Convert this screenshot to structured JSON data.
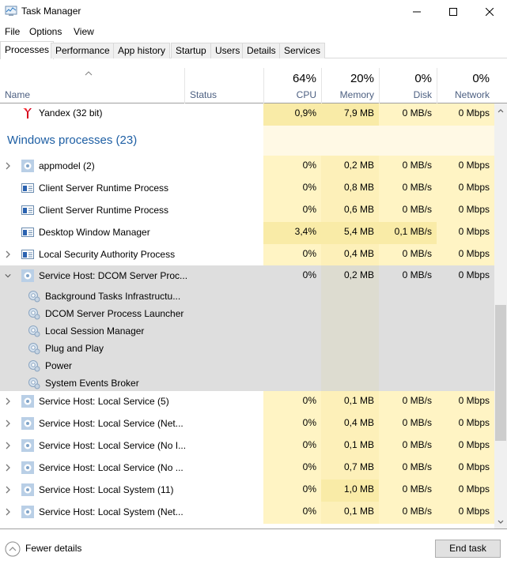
{
  "window": {
    "title": "Task Manager"
  },
  "menu": [
    "File",
    "Options",
    "View"
  ],
  "tabs": [
    {
      "label": "Processes",
      "active": true
    },
    {
      "label": "Performance",
      "active": false
    },
    {
      "label": "App history",
      "active": false
    },
    {
      "label": "Startup",
      "active": false
    },
    {
      "label": "Users",
      "active": false
    },
    {
      "label": "Details",
      "active": false
    },
    {
      "label": "Services",
      "active": false
    }
  ],
  "columns": {
    "name": "Name",
    "status": "Status",
    "cpu": {
      "label": "CPU",
      "total": "64%"
    },
    "memory": {
      "label": "Memory",
      "total": "20%"
    },
    "disk": {
      "label": "Disk",
      "total": "0%"
    },
    "network": {
      "label": "Network",
      "total": "0%"
    }
  },
  "top_row": {
    "name": "Yandex (32 bit)",
    "icon": "yandex-icon",
    "cpu": "0,9%",
    "memory": "7,9 MB",
    "disk": "0 MB/s",
    "network": "0 Mbps"
  },
  "group": {
    "title": "Windows processes (23)"
  },
  "processes_a": [
    {
      "name": "appmodel (2)",
      "icon": "gear-icon",
      "expandable": true,
      "cpu": "0%",
      "memory": "0,2 MB",
      "disk": "0 MB/s",
      "network": "0 Mbps"
    },
    {
      "name": "Client Server Runtime Process",
      "icon": "window-icon",
      "expandable": false,
      "cpu": "0%",
      "memory": "0,8 MB",
      "disk": "0 MB/s",
      "network": "0 Mbps"
    },
    {
      "name": "Client Server Runtime Process",
      "icon": "window-icon",
      "expandable": false,
      "cpu": "0%",
      "memory": "0,6 MB",
      "disk": "0 MB/s",
      "network": "0 Mbps"
    },
    {
      "name": "Desktop Window Manager",
      "icon": "window-icon",
      "expandable": false,
      "cpu": "3,4%",
      "memory": "5,4 MB",
      "disk": "0,1 MB/s",
      "network": "0 Mbps"
    },
    {
      "name": "Local Security Authority Process",
      "icon": "window-icon",
      "expandable": true,
      "cpu": "0%",
      "memory": "0,4 MB",
      "disk": "0 MB/s",
      "network": "0 Mbps"
    }
  ],
  "expanded": {
    "name": "Service Host: DCOM Server Proc...",
    "icon": "gear-icon",
    "cpu": "0%",
    "memory": "0,2 MB",
    "disk": "0 MB/s",
    "network": "0 Mbps",
    "children": [
      "Background Tasks Infrastructu...",
      "DCOM Server Process Launcher",
      "Local Session Manager",
      "Plug and Play",
      "Power",
      "System Events Broker"
    ]
  },
  "processes_b": [
    {
      "name": "Service Host: Local Service (5)",
      "cpu": "0%",
      "memory": "0,1 MB",
      "disk": "0 MB/s",
      "network": "0 Mbps"
    },
    {
      "name": "Service Host: Local Service (Net...",
      "cpu": "0%",
      "memory": "0,4 MB",
      "disk": "0 MB/s",
      "network": "0 Mbps"
    },
    {
      "name": "Service Host: Local Service (No I...",
      "cpu": "0%",
      "memory": "0,1 MB",
      "disk": "0 MB/s",
      "network": "0 Mbps"
    },
    {
      "name": "Service Host: Local Service (No ...",
      "cpu": "0%",
      "memory": "0,7 MB",
      "disk": "0 MB/s",
      "network": "0 Mbps"
    },
    {
      "name": "Service Host: Local System (11)",
      "cpu": "0%",
      "memory": "1,0 MB",
      "disk": "0 MB/s",
      "network": "0 Mbps"
    },
    {
      "name": "Service Host: Local System (Net...",
      "cpu": "0%",
      "memory": "0,1 MB",
      "disk": "0 MB/s",
      "network": "0 Mbps"
    }
  ],
  "footer": {
    "fewer_details": "Fewer details",
    "end_task": "End task"
  },
  "colors": {
    "group_title": "#1e5fa4",
    "header_label": "#4d6082",
    "heat_low": "#fff4c4",
    "heat_mid": "#f9eba7",
    "selected_bg": "#dedede"
  }
}
